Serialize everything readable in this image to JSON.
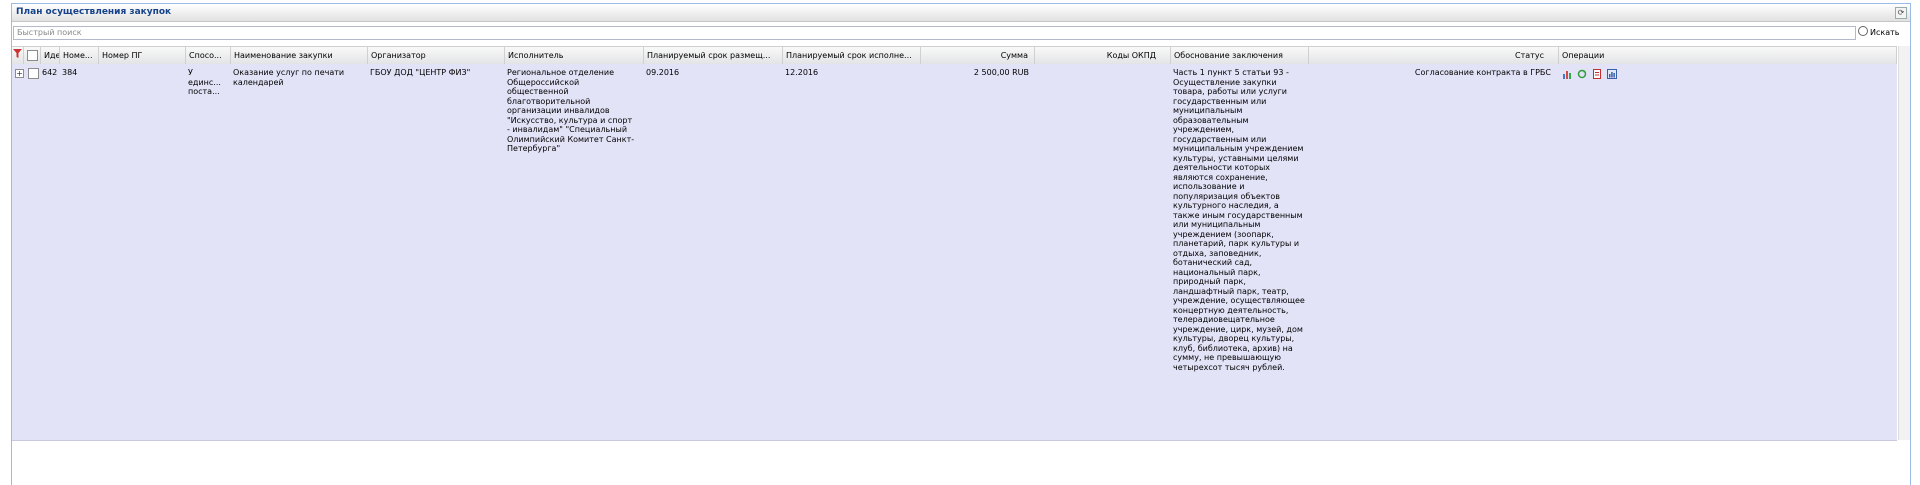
{
  "panel": {
    "title": "План осуществления закупок"
  },
  "search": {
    "placeholder": "Быстрый поиск",
    "button_label": "Искать"
  },
  "columns": [
    "Иде",
    "Номе...",
    "Номер ПГ",
    "Спосо...",
    "Наименование закупки",
    "Организатор",
    "Исполнитель",
    "Планируемый срок размещ...",
    "Планируемый срок исполне...",
    "Сумма",
    "Коды ОКПД",
    "Обоснование заключения",
    "Статус",
    "Операции"
  ],
  "row": {
    "id": "642",
    "number": "384",
    "number_pg": "",
    "method": "У единс... поста...",
    "name": "Оказание услуг по печати календарей",
    "organizer": "ГБОУ ДОД \"ЦЕНТР ФИЗ\"",
    "executor": "Региональное отделение Общероссийской общественной благотворительной организации инвалидов \"Искусство, культура и спорт - инвалидам\" \"Специальный Олимпийский Комитет Санкт-Петербурга\"",
    "planned_placement": "09.2016",
    "planned_execution": "12.2016",
    "sum": "2 500,00 RUB",
    "okpd": "",
    "justification": "Часть 1 пункт 5 статьи 93 - Осуществление закупки товара, работы или услуги государственным или муниципальным образовательным учреждением, государственным или муниципальным учреждением культуры, уставными целями деятельности которых являются сохранение, использование и популяризация объектов культурного наследия, а также иным государственным или муниципальным учреждением (зоопарк, планетарий, парк культуры и отдыха, заповедник, ботанический сад, национальный парк, природный парк, ландшафтный парк, театр, учреждение, осуществляющее концертную деятельность, телерадиовещательное учреждение, цирк, музей, дом культуры, дворец культуры, клуб, библиотека, архив) на сумму, не превышающую четырехсот тысяч рублей.",
    "status": "Согласование контракта в ГРБС"
  },
  "icons": {
    "header_filter": "filter-clear-icon",
    "ops": [
      "chart-icon",
      "refresh-icon",
      "document-icon",
      "report-icon"
    ]
  },
  "colors": {
    "row_bg": "#e3e3f8",
    "title": "#15428b",
    "border": "#99bbe8"
  }
}
